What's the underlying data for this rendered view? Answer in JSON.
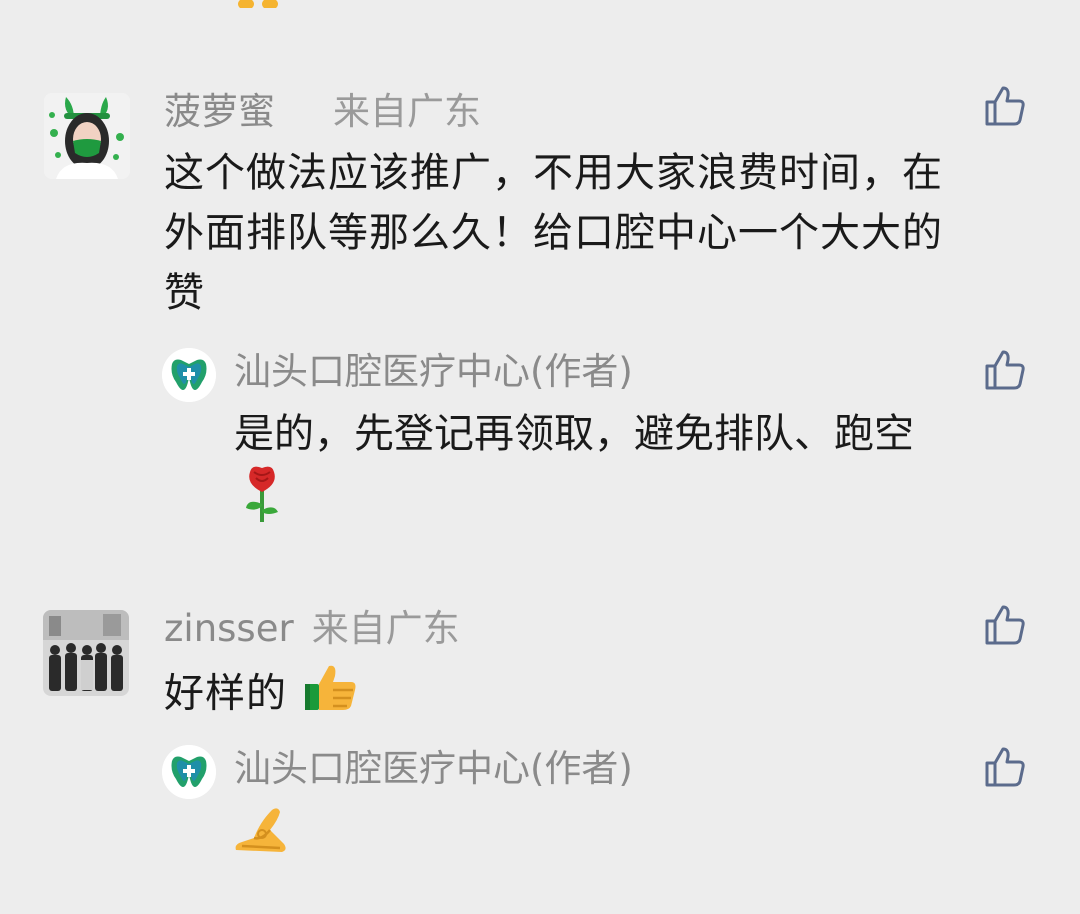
{
  "comments": [
    {
      "username": "菠萝蜜",
      "location": "来自广东",
      "text": "这个做法应该推广，不用大家浪费时间，在外面排队等那么久！给口腔中心一个大大的赞",
      "text_lines": [
        "这个做法应该推广，不用大家浪费时间，在",
        "外面排队等那么久！给口腔中心一个大大的",
        "赞"
      ],
      "avatar_icon": "green-bunny-ears-avatar",
      "reply": {
        "author": "汕头口腔医疗中心(作者)",
        "text": "是的，先登记再领取，避免排队、跑空",
        "emoji": "rose-emoji"
      }
    },
    {
      "username": "zinsser",
      "location": "来自广东",
      "text": "好样的",
      "emoji": "thumbs-up-emoji",
      "avatar_icon": "group-photo-avatar",
      "reply": {
        "author": "汕头口腔医疗中心(作者)",
        "text": "",
        "emoji": "ok-hand-emoji"
      }
    }
  ],
  "colors": {
    "background": "#ededed",
    "text_primary": "#1a1a1a",
    "text_secondary": "#8a8a8a",
    "like_icon": "#5b6b8c",
    "brand_green": "#22a06b",
    "brand_teal": "#1f8fa8"
  }
}
